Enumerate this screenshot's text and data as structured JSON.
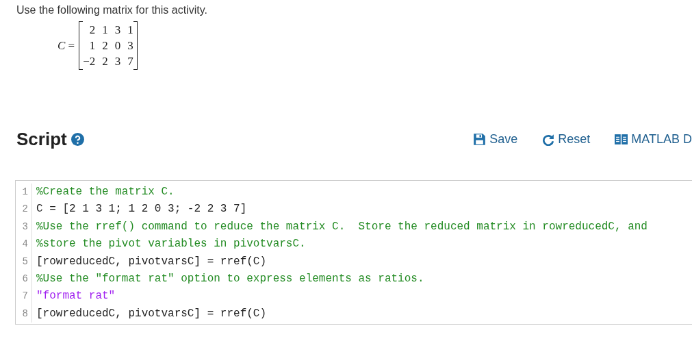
{
  "instruction": "Use the following matrix for this activity.",
  "matrix": {
    "label": "*C* =",
    "rows": [
      [
        "2",
        "1",
        "3",
        "1"
      ],
      [
        "1",
        "2",
        "0",
        "3"
      ],
      [
        "−2",
        "2",
        "3",
        "7"
      ]
    ]
  },
  "script": {
    "title": "Script",
    "buttons": [
      {
        "kind": "save",
        "label": "Save"
      },
      {
        "kind": "reset",
        "label": "Reset"
      },
      {
        "kind": "docs",
        "label": "MATLAB D"
      }
    ],
    "lines": [
      {
        "number": "1",
        "kind": "comment",
        "text": "%Create the matrix C."
      },
      {
        "number": "2",
        "kind": "code",
        "text": "C = [2 1 3 1; 1 2 0 3; -2 2 3 7]"
      },
      {
        "number": "3",
        "kind": "comment",
        "text": "%Use the rref() command to reduce the matrix C.  Store the reduced matrix in rowreducedC, and"
      },
      {
        "number": "4",
        "kind": "comment",
        "text": "%store the pivot variables in pivotvarsC."
      },
      {
        "number": "5",
        "kind": "code",
        "text": "[rowreducedC, pivotvarsC] = rref(C)"
      },
      {
        "number": "6",
        "kind": "comment",
        "text": "%Use the \"format rat\" option to express elements as ratios."
      },
      {
        "number": "7",
        "kind": "string",
        "text": "\"format rat\""
      },
      {
        "number": "8",
        "kind": "code",
        "text": "[rowreducedC, pivotvarsC] = rref(C)"
      }
    ]
  }
}
